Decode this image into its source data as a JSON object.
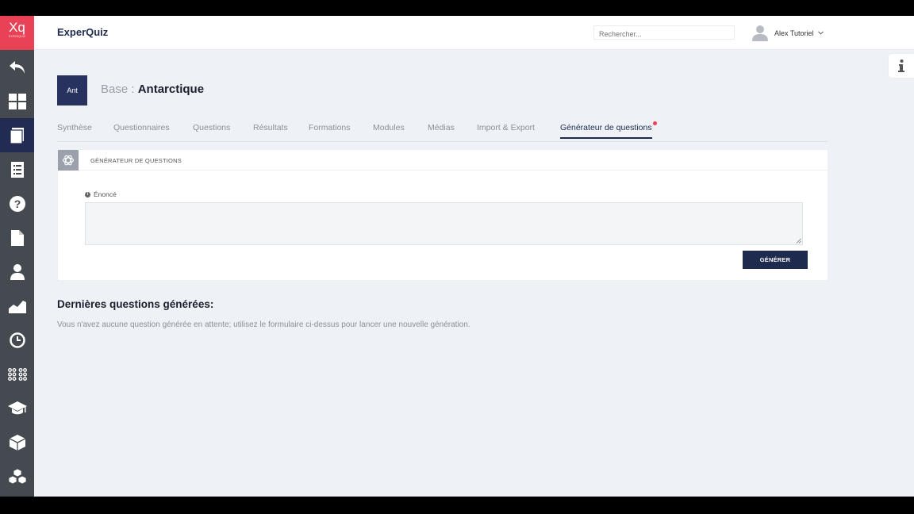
{
  "logo": {
    "text": "Xq",
    "subtext": "EXPERQUIZ"
  },
  "topbar": {
    "app_title": "ExperQuiz",
    "search_placeholder": "Rechercher...",
    "user_name": "Alex Tutoriel"
  },
  "sidebar": {
    "items": [
      {
        "icon": "back-arrow-icon"
      },
      {
        "icon": "dashboard-icon"
      },
      {
        "icon": "book-icon",
        "active": true
      },
      {
        "icon": "list-icon"
      },
      {
        "icon": "question-icon"
      },
      {
        "icon": "document-icon"
      },
      {
        "icon": "user-icon"
      },
      {
        "icon": "chart-icon"
      },
      {
        "icon": "clock-icon"
      },
      {
        "icon": "apps-icon"
      },
      {
        "icon": "graduation-cap-icon"
      },
      {
        "icon": "cube-icon"
      },
      {
        "icon": "cubes-icon"
      }
    ]
  },
  "header": {
    "badge": "Ant",
    "prefix": "Base : ",
    "name": "Antarctique"
  },
  "tabs": [
    {
      "label": "Synthèse"
    },
    {
      "label": "Questionnaires"
    },
    {
      "label": "Questions"
    },
    {
      "label": "Résultats"
    },
    {
      "label": "Formations"
    },
    {
      "label": "Modules"
    },
    {
      "label": "Médias"
    },
    {
      "label": "Import & Export"
    },
    {
      "label": "Générateur de questions",
      "active": true
    }
  ],
  "panel": {
    "title": "Générateur de questions",
    "field_label": "Énoncé",
    "field_value": "",
    "button_label": "GÉNÉRER"
  },
  "latest": {
    "title": "Dernières questions générées:",
    "empty_message": "Vous n'avez aucune question générée en attente; utilisez le formulaire ci-dessus pour lancer une nouvelle génération."
  },
  "colors": {
    "brand": "#e94256",
    "navy": "#1f2a4f",
    "sidebar": "#454a51",
    "background": "#eef1f5"
  }
}
